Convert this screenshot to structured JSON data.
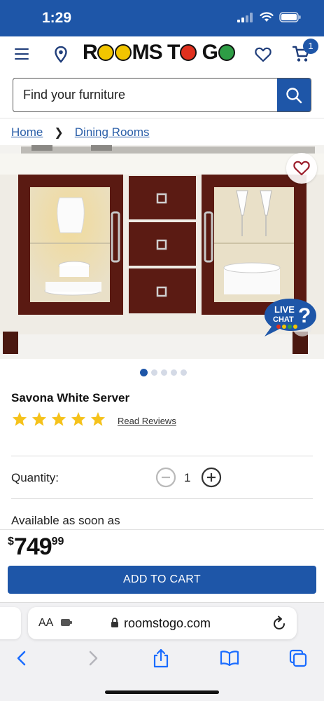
{
  "status_bar": {
    "time": "1:29"
  },
  "header": {
    "logo_text": "ROOMS TO GO",
    "cart_count": "1",
    "colors": {
      "brand_blue": "#1e56a8"
    }
  },
  "search": {
    "placeholder": "Find your furniture"
  },
  "breadcrumb": {
    "items": [
      "Home",
      "Dining Rooms"
    ]
  },
  "product": {
    "name": "Savona White Server",
    "rating": 5,
    "rating_max": 5,
    "reviews_link": "Read Reviews",
    "image_count": 5,
    "active_image": 1,
    "live_chat": "LIVE CHAT"
  },
  "quantity": {
    "label": "Quantity:",
    "value": "1"
  },
  "availability": {
    "text": "Available as soon as"
  },
  "price": {
    "currency": "$",
    "dollars": "749",
    "cents": "99"
  },
  "cart_button": {
    "label": "ADD TO CART"
  },
  "browser": {
    "aa_label": "AA",
    "url": "roomstogo.com"
  }
}
